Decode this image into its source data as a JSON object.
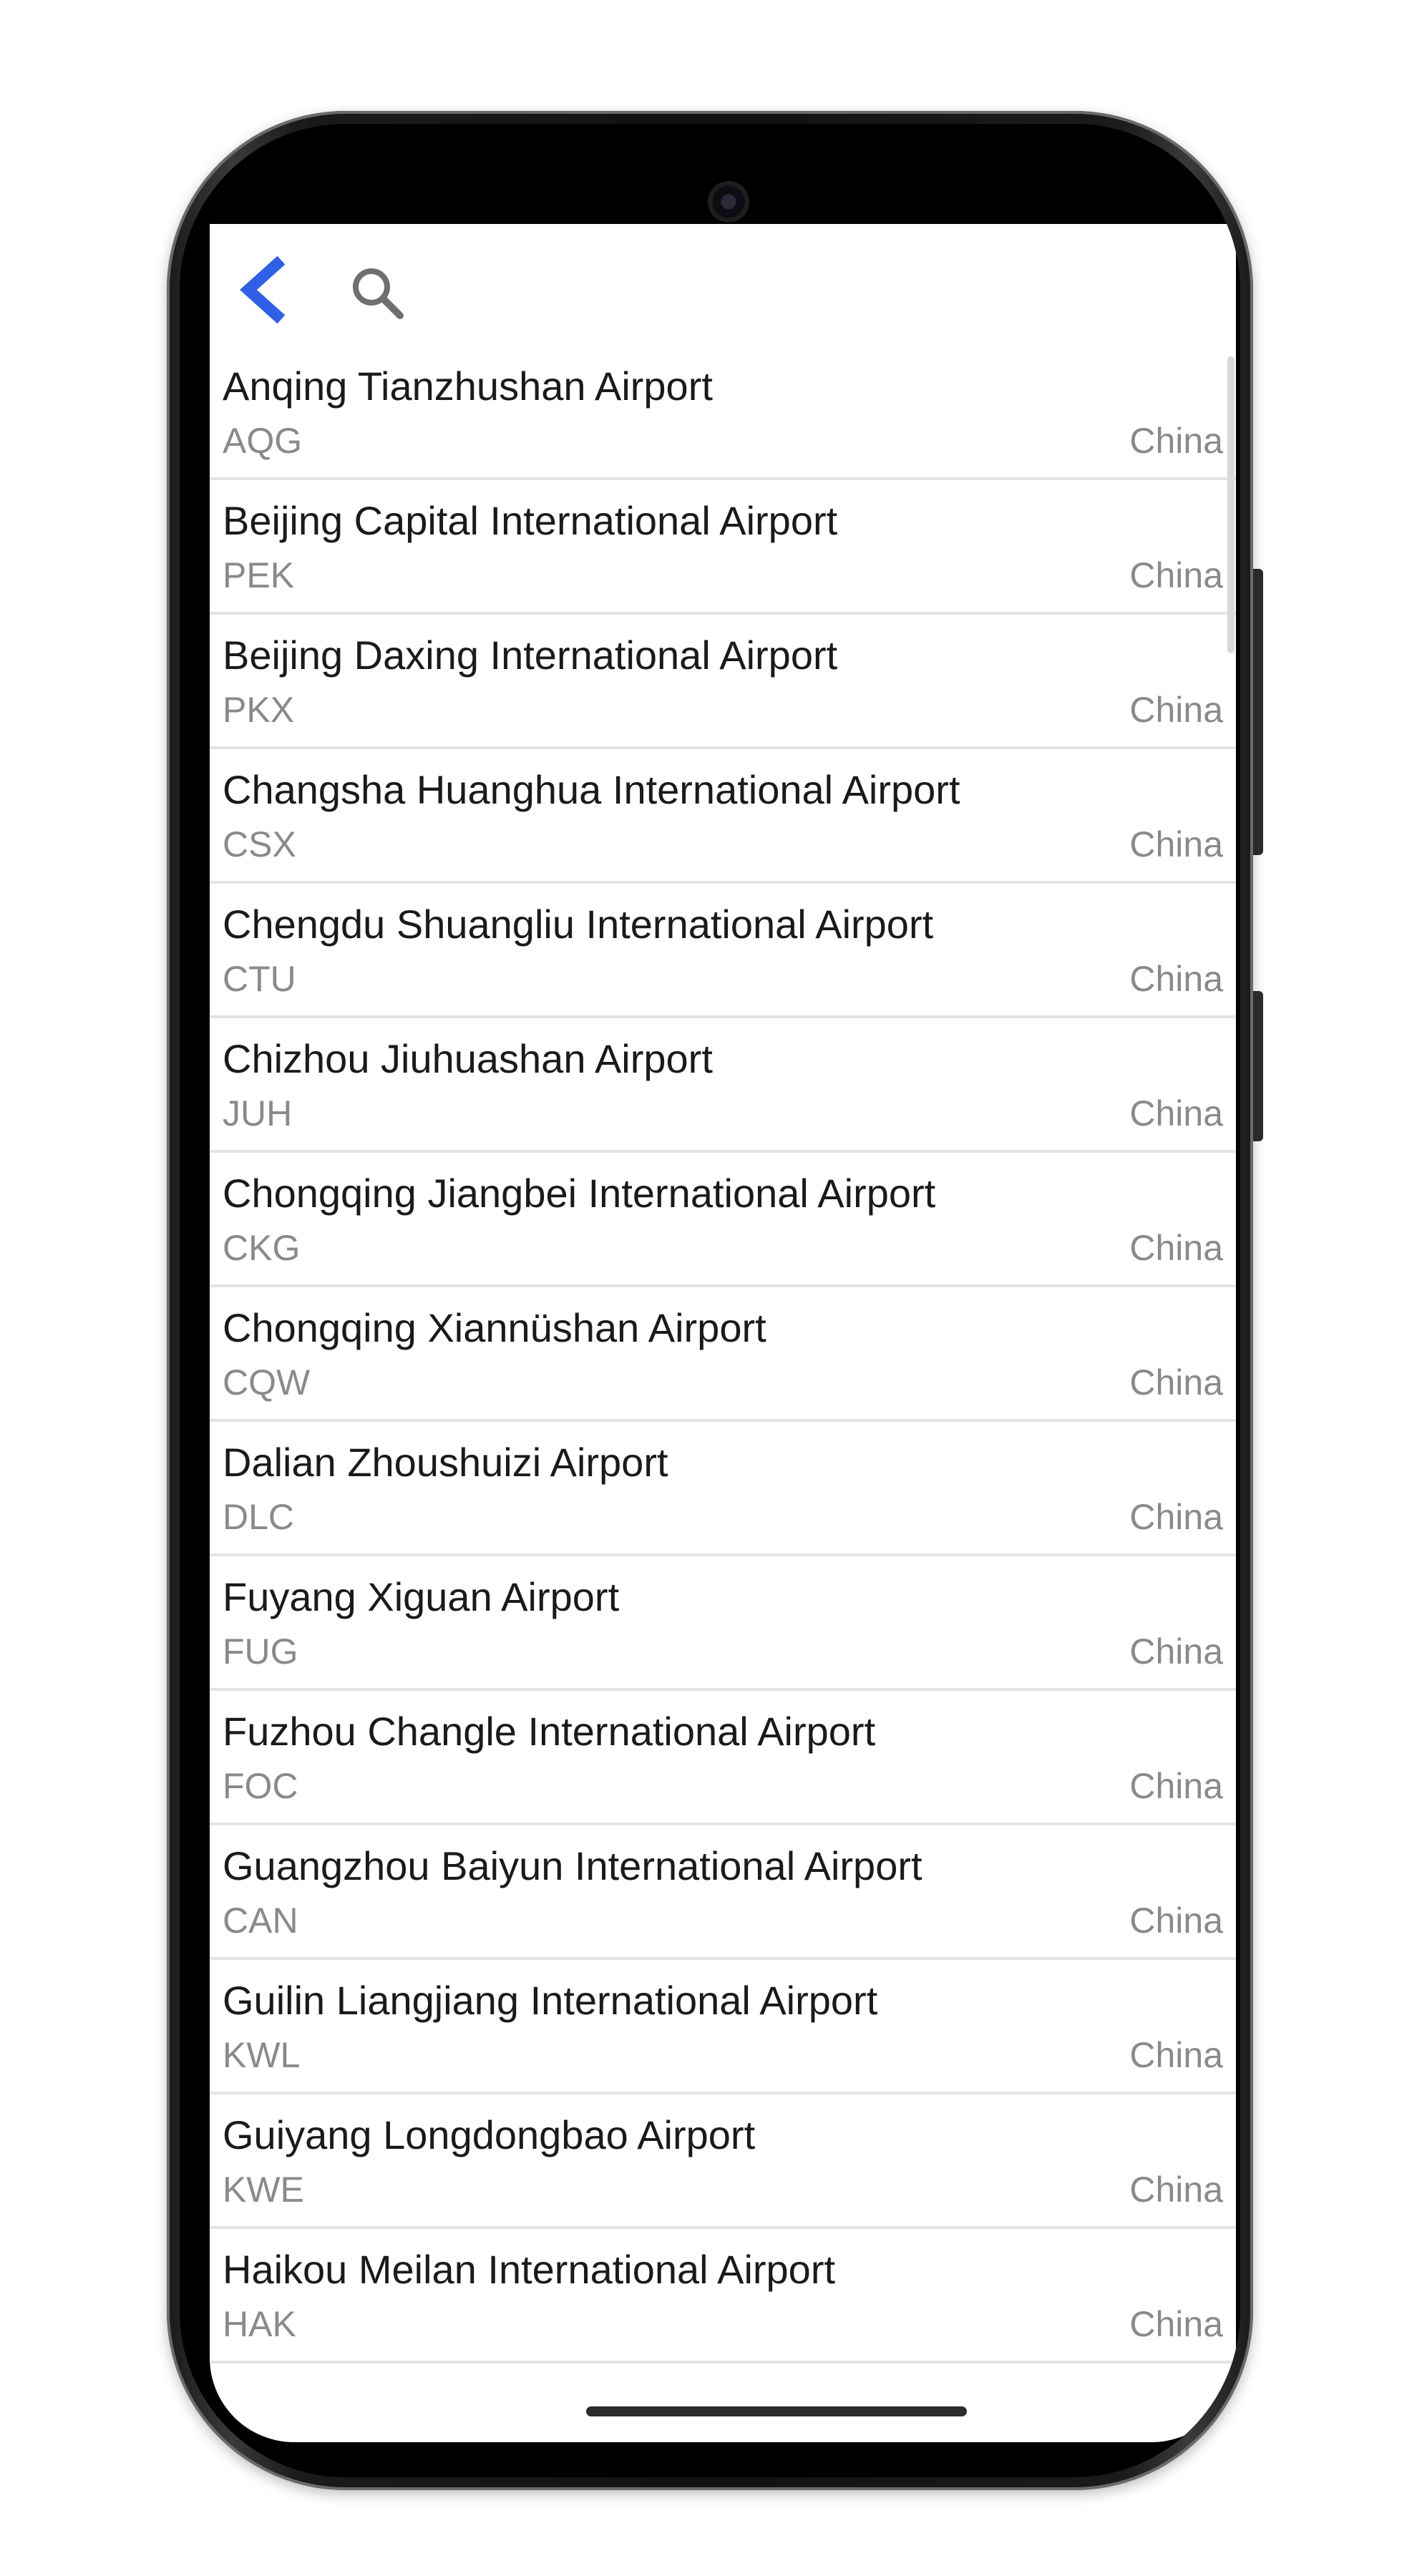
{
  "toolbar": {
    "back_icon": "chevron-left-icon",
    "search_icon": "search-icon",
    "accent_color": "#2f5fe6"
  },
  "airports": [
    {
      "name": "Anqing Tianzhushan Airport",
      "code": "AQG",
      "country": "China"
    },
    {
      "name": "Beijing Capital International Airport",
      "code": "PEK",
      "country": "China"
    },
    {
      "name": "Beijing Daxing International Airport",
      "code": "PKX",
      "country": "China"
    },
    {
      "name": "Changsha Huanghua International Airport",
      "code": "CSX",
      "country": "China"
    },
    {
      "name": "Chengdu Shuangliu International Airport",
      "code": "CTU",
      "country": "China"
    },
    {
      "name": "Chizhou Jiuhuashan Airport",
      "code": "JUH",
      "country": "China"
    },
    {
      "name": "Chongqing Jiangbei International Airport",
      "code": "CKG",
      "country": "China"
    },
    {
      "name": "Chongqing Xiannüshan Airport",
      "code": "CQW",
      "country": "China"
    },
    {
      "name": "Dalian Zhoushuizi Airport",
      "code": "DLC",
      "country": "China"
    },
    {
      "name": "Fuyang Xiguan Airport",
      "code": "FUG",
      "country": "China"
    },
    {
      "name": "Fuzhou Changle International Airport",
      "code": "FOC",
      "country": "China"
    },
    {
      "name": "Guangzhou Baiyun International Airport",
      "code": "CAN",
      "country": "China"
    },
    {
      "name": "Guilin Liangjiang International Airport",
      "code": "KWL",
      "country": "China"
    },
    {
      "name": "Guiyang Longdongbao Airport",
      "code": "KWE",
      "country": "China"
    },
    {
      "name": "Haikou Meilan International Airport",
      "code": "HAK",
      "country": "China"
    }
  ]
}
